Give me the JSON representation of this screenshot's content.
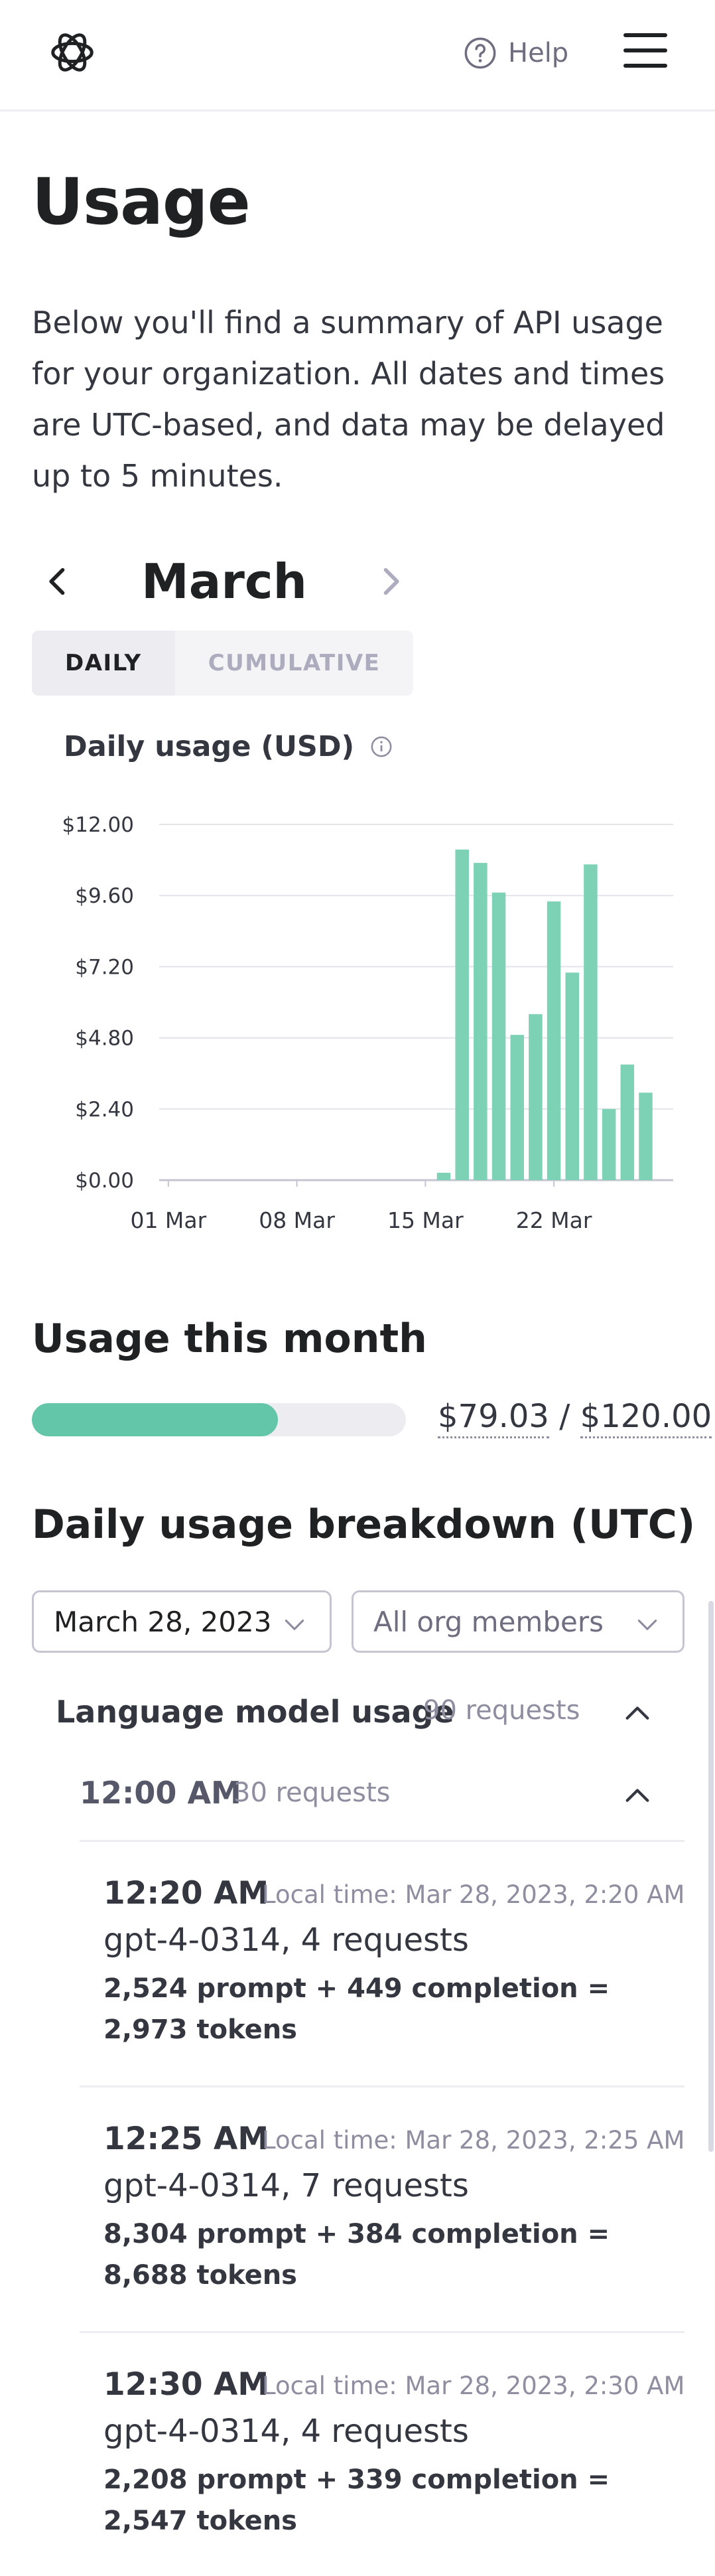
{
  "header": {
    "help_label": "Help",
    "icons": [
      "openai-logo-icon",
      "help-circle-icon",
      "hamburger-menu-icon"
    ]
  },
  "page": {
    "title": "Usage",
    "intro": "Below you'll find a summary of API usage for your organization. All dates and times are UTC-based, and data may be delayed up to 5 minutes."
  },
  "month_nav": {
    "month": "March"
  },
  "view_toggle": {
    "options": [
      "DAILY",
      "CUMULATIVE"
    ],
    "selected": "DAILY"
  },
  "chart_data": {
    "type": "bar",
    "title": "Daily usage (USD)",
    "xlabel": "",
    "ylabel": "",
    "ylim": [
      0,
      12
    ],
    "y_ticks": [
      "$12.00",
      "$9.60",
      "$7.20",
      "$4.80",
      "$2.40",
      "$0.00"
    ],
    "y_tick_values": [
      12,
      9.6,
      7.2,
      4.8,
      2.4,
      0
    ],
    "x_ticks": [
      "01 Mar",
      "08 Mar",
      "15 Mar",
      "22 Mar"
    ],
    "x_tick_days": [
      1,
      8,
      15,
      22
    ],
    "days": [
      1,
      2,
      3,
      4,
      5,
      6,
      7,
      8,
      9,
      10,
      11,
      12,
      13,
      14,
      15,
      16,
      17,
      18,
      19,
      20,
      21,
      22,
      23,
      24,
      25,
      26,
      27,
      28
    ],
    "values": [
      0,
      0,
      0,
      0,
      0,
      0,
      0,
      0,
      0,
      0,
      0,
      0,
      0,
      0,
      0,
      0.25,
      11.15,
      10.7,
      9.7,
      4.9,
      5.6,
      9.4,
      7.0,
      10.65,
      2.4,
      3.9,
      2.95,
      0
    ],
    "bar_color": "#7dd1b5",
    "grid": true
  },
  "usage_month": {
    "title": "Usage this month",
    "used": "$79.03",
    "separator": "/",
    "limit": "$120.00",
    "fraction": 0.6586,
    "bar_color": "#63c6a8"
  },
  "breakdown": {
    "title": "Daily usage breakdown (UTC)",
    "date_select": "March 28, 2023",
    "member_select": "All org members",
    "section": {
      "label": "Language model usage",
      "count": "90 requests"
    },
    "hour": {
      "label": "12:00 AM",
      "count": "30 requests"
    },
    "entries": [
      {
        "time": "12:20 AM",
        "local": "Local time: Mar 28, 2023, 2:20 AM",
        "model": "gpt-4-0314, 4 requests",
        "tokens": "2,524 prompt + 449 completion = 2,973 tokens"
      },
      {
        "time": "12:25 AM",
        "local": "Local time: Mar 28, 2023, 2:25 AM",
        "model": "gpt-4-0314, 7 requests",
        "tokens": "8,304 prompt + 384 completion = 8,688 tokens"
      },
      {
        "time": "12:30 AM",
        "local": "Local time: Mar 28, 2023, 2:30 AM",
        "model": "gpt-4-0314, 4 requests",
        "tokens": "2,208 prompt + 339 completion = 2,547 tokens"
      }
    ]
  }
}
